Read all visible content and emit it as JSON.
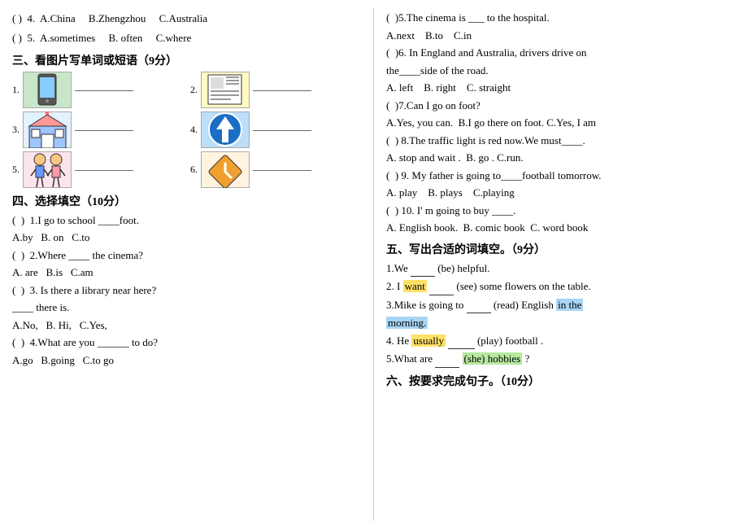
{
  "left": {
    "q4": {
      "paren": "( )",
      "num": "4.",
      "a": "A.China",
      "b": "B.Zhengzhou",
      "c": "C.Australia"
    },
    "q5": {
      "paren": "( )",
      "num": "5.",
      "a": "A.sometimes",
      "b": "B. often",
      "c": "C.where"
    },
    "section3": {
      "title": "三、看图片写单词或短语（9分）"
    },
    "images": [
      {
        "num": "1.",
        "label": "手机"
      },
      {
        "num": "2.",
        "label": "报纸"
      },
      {
        "num": "3.",
        "label": "学校"
      },
      {
        "num": "4.",
        "label": "向上箭头"
      },
      {
        "num": "5.",
        "label": "小朋友"
      },
      {
        "num": "6.",
        "label": "转弯标志"
      }
    ],
    "section4": {
      "title": "四、选择填空（10分）"
    },
    "choices": [
      {
        "paren": "( )",
        "num": "1.",
        "text": "I go to school ____foot.",
        "options": "A.by  B. on   C.to"
      },
      {
        "paren": "( )",
        "num": "2.",
        "text": "Where ____ the cinema?",
        "options": "A. are   B.is   C.am"
      },
      {
        "paren": "( )",
        "num": "3.",
        "text": "Is there a library near here?",
        "sub": "____ there is.",
        "options": "A.No,   B. Hi,  C.Yes,"
      },
      {
        "paren": "( )",
        "num": "4.",
        "text": "What are you ______ to do?",
        "options": "A.go   B.going   C.to go"
      }
    ]
  },
  "right": {
    "mc_questions": [
      {
        "paren": "( )",
        "num": "5.",
        "text": "The cinema is ___ to the hospital.",
        "options": "A.next    B.to    C.in"
      },
      {
        "paren": "( )",
        "num": "6.",
        "text": "In England and Australia, drivers drive on the____side of the road.",
        "options": "A. left    B. right    C. straight"
      },
      {
        "paren": "( )",
        "num": "7.",
        "text": "Can I go on foot?",
        "options": "A.Yes, you can.  B.I go there on foot. C.Yes, I am"
      },
      {
        "paren": "( )",
        "num": "8.",
        "text": "The traffic light is red now.We must____.",
        "options": "A. stop and wait .  B. go . C.run."
      },
      {
        "paren": "( )",
        "num": "9.",
        "text": "My father is going to____football tomorrow.",
        "options": "A. play    B. plays    C.playing"
      },
      {
        "paren": "( )",
        "num": "10.",
        "text": "I' m going to buy ____.",
        "options": "A. English book.  B. comic book  C. word book"
      }
    ],
    "section5": {
      "title": "五、写出合适的词填空。（9分）"
    },
    "fill_items": [
      {
        "num": "1.",
        "prefix": "We",
        "blank": "______",
        "suffix": "(be) helpful."
      },
      {
        "num": "2.",
        "prefix": "I",
        "want_hl": "want",
        "blank": "__________",
        "suffix": "(see) some flowers on the table."
      },
      {
        "num": "3.",
        "prefix": "Mike is going to",
        "blank": "______",
        "suffix": "(read) English",
        "hl1": "in the",
        "hl2": "morning."
      },
      {
        "num": "4.",
        "prefix": "He",
        "usually_hl": "usually",
        "blank": "____________",
        "suffix": "(play) football ."
      },
      {
        "num": "5.",
        "prefix": "What are",
        "blank": "______",
        "she_hl": "(she) hobbies",
        "suffix": "?"
      }
    ],
    "section6": {
      "title": "六、按要求完成句子。（10分）"
    }
  }
}
